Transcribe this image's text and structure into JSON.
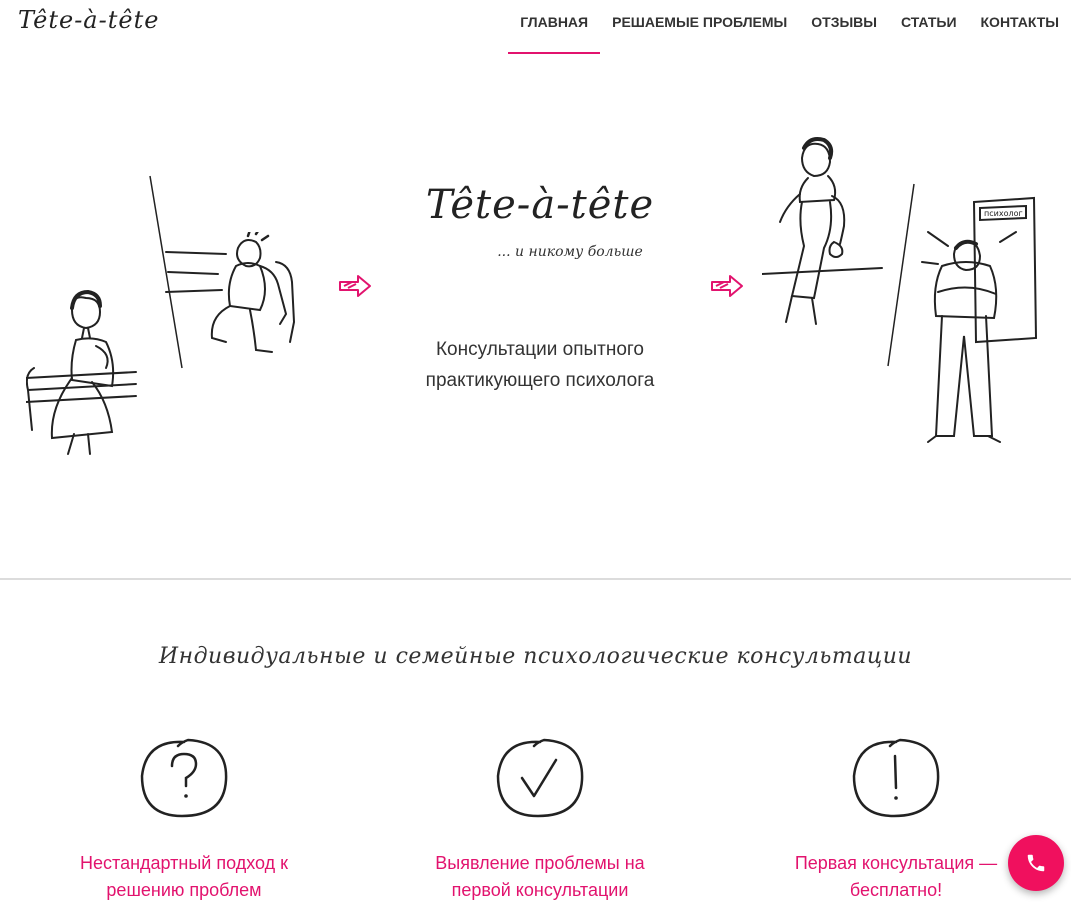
{
  "header": {
    "logo": "Tête-à-tête",
    "nav": [
      {
        "label": "ГЛАВНАЯ",
        "active": true
      },
      {
        "label": "РЕШАЕМЫЕ ПРОБЛЕМЫ",
        "active": false
      },
      {
        "label": "ОТЗЫВЫ",
        "active": false
      },
      {
        "label": "СТАТЬИ",
        "active": false
      },
      {
        "label": "КОНТАКТЫ",
        "active": false
      }
    ]
  },
  "hero": {
    "title": "Tête-à-tête",
    "tagline": "... и никому больше",
    "description": "Консультации опытного практикующего психолога"
  },
  "section": {
    "title": "Индивидуальные и семейные психологические консультации"
  },
  "features": [
    {
      "icon": "question-mark-icon",
      "text": "Нестандартный подход к решению проблем"
    },
    {
      "icon": "checkmark-icon",
      "text": "Выявление проблемы на первой консультации"
    },
    {
      "icon": "exclamation-mark-icon",
      "text": "Первая консультация — бесплатно!"
    }
  ],
  "door_sign": "психолог",
  "colors": {
    "accent": "#e2136e",
    "fab": "#f0105e",
    "text": "#333333",
    "divider": "#dcdcdc"
  },
  "fab": {
    "icon": "phone-icon"
  }
}
